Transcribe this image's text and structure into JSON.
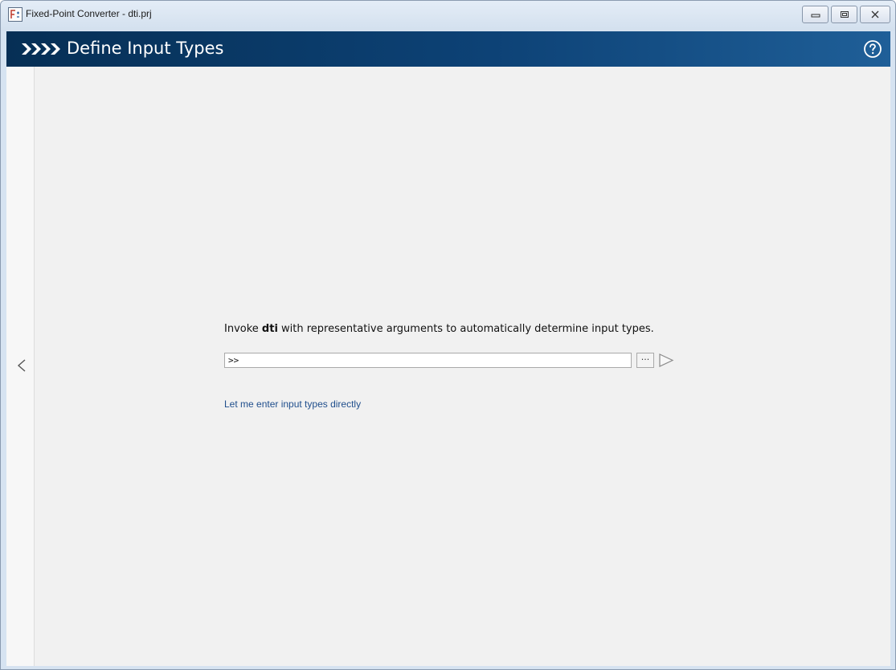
{
  "window": {
    "title": "Fixed-Point Converter - dti.prj",
    "controls": {
      "minimize": "minimize-icon",
      "maximize": "maximize-icon",
      "close": "close-icon"
    }
  },
  "header": {
    "title": "Define Input Types",
    "arrows_icon": "workflow-arrows-icon",
    "help_icon": "help-icon",
    "colors": {
      "gradient_start": "#062f55",
      "gradient_end": "#1f5f98"
    }
  },
  "nav": {
    "back_icon": "chevron-left-icon"
  },
  "main": {
    "prompt_before": "Invoke ",
    "function_name": "dti",
    "prompt_after": " with representative arguments to automatically determine input types.",
    "command_value": ">>",
    "browse_label": "···",
    "run_icon": "play-triangle-icon",
    "link_text": "Let me enter input types directly",
    "link_color": "#1f4e8c"
  }
}
